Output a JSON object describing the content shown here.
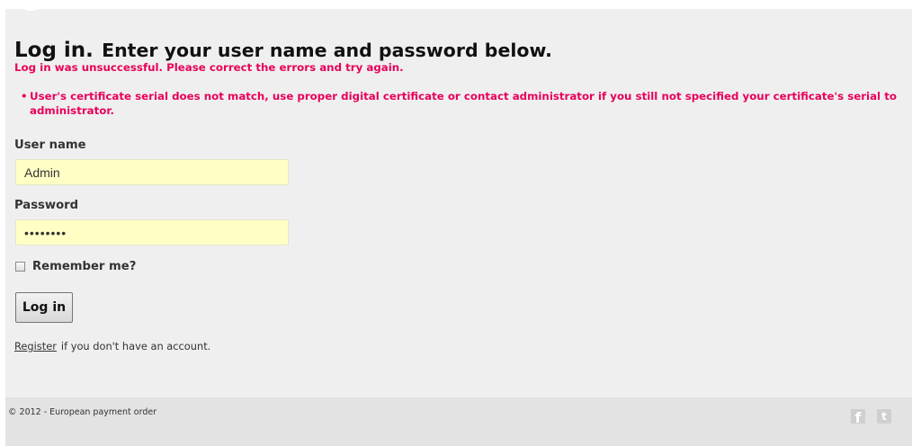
{
  "login": {
    "heading": {
      "strong": "Log in.",
      "rest": "Enter your user name and password below."
    },
    "validation": {
      "summary": "Log in was unsuccessful. Please correct the errors and try again.",
      "items": [
        {
          "text": "User's certificate serial does not match, use proper digital certificate or contact administrator if you still not specified your certificate's serial to administrator."
        }
      ]
    },
    "fields": {
      "username": {
        "label": "User name",
        "value": "Admin",
        "placeholder": ""
      },
      "password": {
        "label": "Password",
        "display": "••••••••",
        "placeholder": ""
      },
      "remember": {
        "label": "Remember me?"
      }
    },
    "actions": {
      "login_label": "Log in"
    },
    "register": {
      "link_text": "Register",
      "suffix": "if you don't have an account."
    }
  },
  "footer": {
    "copyright": "© 2012 - European payment order",
    "social": [
      {
        "icon": "facebook-icon",
        "glyph": "f"
      },
      {
        "icon": "twitter-icon",
        "glyph": "t"
      }
    ]
  },
  "theme": {
    "error_color": "#e8005a",
    "input_background": "#ffffc5",
    "panel_background": "#efefef",
    "footer_background": "#e3e3e3"
  }
}
